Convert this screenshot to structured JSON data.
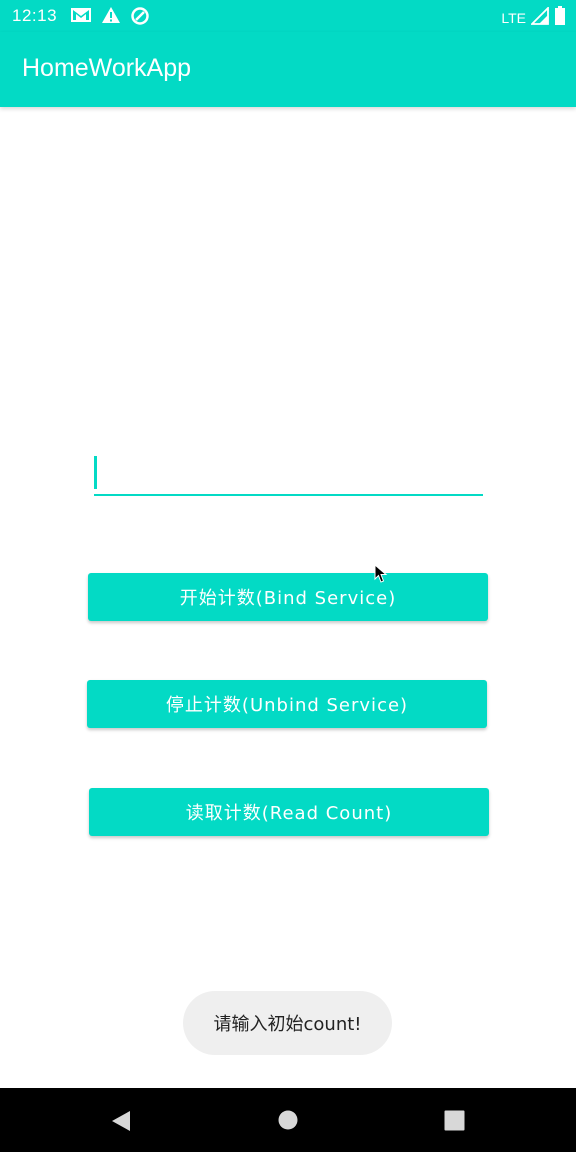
{
  "status_bar": {
    "time": "12:13",
    "network": "LTE",
    "left_icons": [
      "gmail-icon",
      "warning-icon",
      "data-saver-icon"
    ],
    "right_icons": [
      "signal-icon",
      "battery-icon"
    ]
  },
  "app_bar": {
    "title": "HomeWorkApp"
  },
  "input": {
    "value": "",
    "placeholder": ""
  },
  "buttons": {
    "bind": "开始计数(Bind Service)",
    "unbind": "停止计数(Unbind Service)",
    "read": "读取计数(Read Count)"
  },
  "toast": {
    "message": "请输入初始count!"
  },
  "nav_bar": {
    "buttons": [
      "back-icon",
      "home-icon",
      "recents-icon"
    ]
  },
  "colors": {
    "accent": "#03dac5",
    "toast_bg": "#efefef",
    "nav_bg": "#000000"
  }
}
